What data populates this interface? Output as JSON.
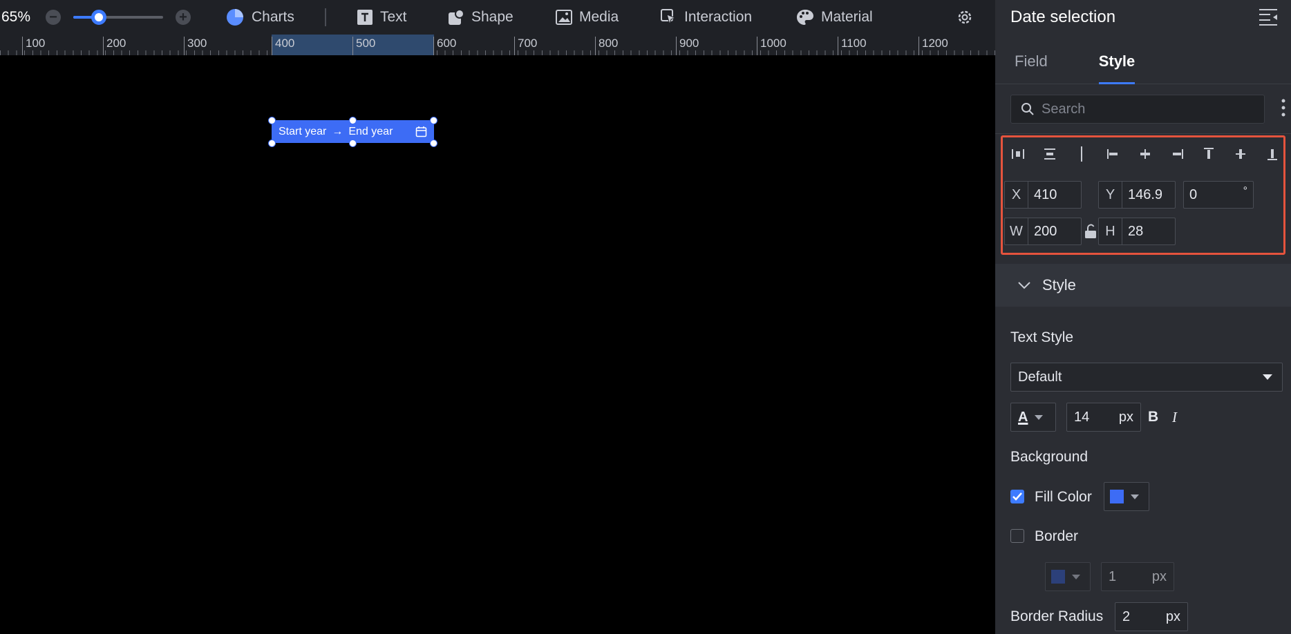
{
  "toolbar": {
    "zoom": "65%",
    "zoom_level": 0.3,
    "items": [
      {
        "label": "Charts",
        "icon": "pie-chart-icon"
      },
      {
        "label": "Text",
        "icon": "text-icon"
      },
      {
        "label": "Shape",
        "icon": "shape-icon"
      },
      {
        "label": "Media",
        "icon": "image-icon"
      },
      {
        "label": "Interaction",
        "icon": "cursor-click-icon"
      },
      {
        "label": "Material",
        "icon": "palette-icon"
      }
    ]
  },
  "ruler": {
    "marks": [
      "100",
      "200",
      "300",
      "400",
      "500",
      "600",
      "700",
      "800",
      "900",
      "1000",
      "1100",
      "1200"
    ]
  },
  "widget": {
    "start": "Start year",
    "arrow": "→",
    "end": "End year",
    "color": "#3d6cf5"
  },
  "panel": {
    "title": "Date selection",
    "tabs": [
      "Field",
      "Style"
    ],
    "active_tab": "Style",
    "search_placeholder": "Search",
    "geometry": {
      "x_label": "X",
      "x": "410",
      "y_label": "Y",
      "y": "146.9",
      "rotation": "0",
      "rotation_unit": "°",
      "w_label": "W",
      "w": "200",
      "h_label": "H",
      "h": "28"
    },
    "section": "Style",
    "text_style_label": "Text Style",
    "text_style_value": "Default",
    "font_color_glyph": "A",
    "font_size": "14",
    "font_unit": "px",
    "bold": "B",
    "italic": "I",
    "background_label": "Background",
    "fill_color_label": "Fill Color",
    "fill_color_checked": true,
    "fill_color": "#3d6cf5",
    "border_label": "Border",
    "border_checked": false,
    "border_color": "#2e4da8",
    "border_width": "1",
    "border_unit": "px",
    "radius_label": "Border Radius",
    "radius": "2",
    "radius_unit": "px"
  },
  "accent": "#3d7bff",
  "highlight": "#e5533d"
}
